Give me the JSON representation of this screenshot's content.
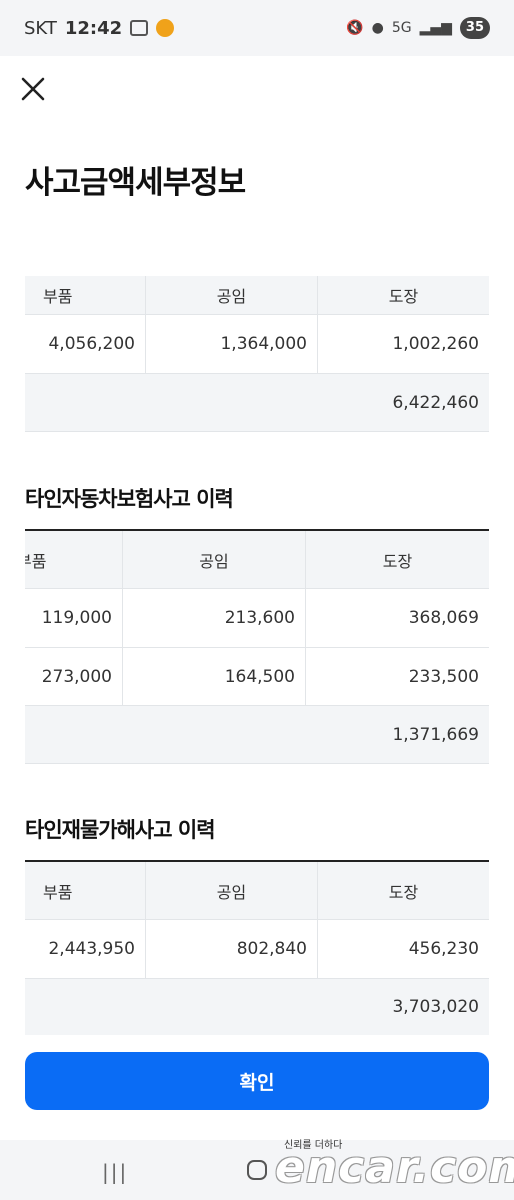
{
  "statusbar": {
    "carrier": "SKT",
    "time": "12:42",
    "network": "5G",
    "battery": "35"
  },
  "page": {
    "title": "사고금액세부정보",
    "close_icon": "close-icon"
  },
  "table_my": {
    "headers": [
      "부품",
      "공임",
      "도장"
    ],
    "rows": [
      [
        "4,056,200",
        "1,364,000",
        "1,002,260"
      ]
    ],
    "total": "6,422,460"
  },
  "table_other_car": {
    "title": "타인자동차보험사고 이력",
    "headers": [
      "부품",
      "공임",
      "도장"
    ],
    "rows": [
      [
        "119,000",
        "213,600",
        "368,069"
      ],
      [
        "273,000",
        "164,500",
        "233,500"
      ]
    ],
    "total": "1,371,669"
  },
  "table_other_property": {
    "title": "타인재물가해사고 이력",
    "headers": [
      "부품",
      "공임",
      "도장"
    ],
    "rows": [
      [
        "2,443,950",
        "802,840",
        "456,230"
      ]
    ],
    "total": "3,703,020"
  },
  "footer": {
    "confirm_label": "확인"
  },
  "watermark": {
    "slogan": "신뢰를 더하다",
    "brand": "encar.com"
  }
}
